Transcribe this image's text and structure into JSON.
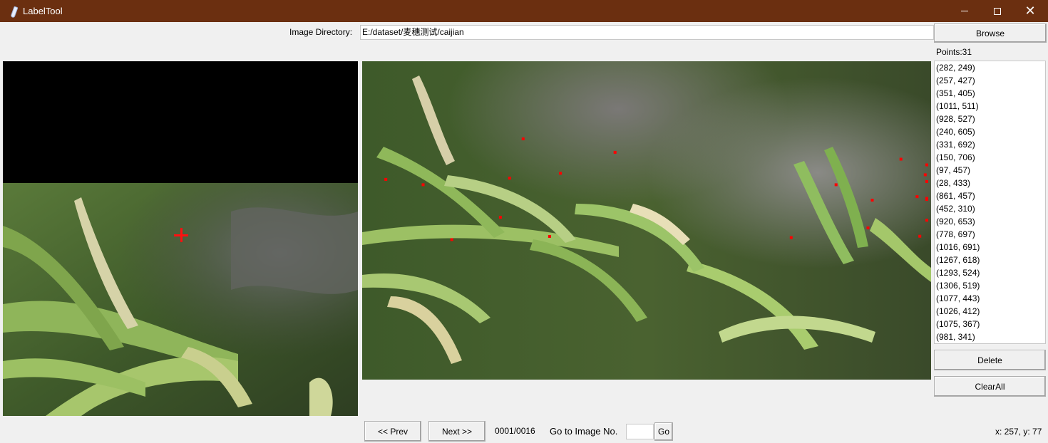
{
  "window": {
    "title": "LabelTool",
    "icon": "feather-icon",
    "controls": [
      "minimize-icon",
      "maximize-icon",
      "close-icon"
    ]
  },
  "directory": {
    "label": "Image Directory:",
    "value": "E:/dataset/麦穗测试/caijian",
    "browse_label": "Browse"
  },
  "points": {
    "label": "Points:31",
    "items": [
      "(282, 249)",
      "(257, 427)",
      "(351, 405)",
      "(1011, 511)",
      "(928, 527)",
      "(240, 605)",
      "(331, 692)",
      "(150, 706)",
      "(97, 457)",
      "(28, 433)",
      "(861, 457)",
      "(452, 310)",
      "(920, 653)",
      "(778, 697)",
      "(1016, 691)",
      "(1267, 618)",
      "(1293, 524)",
      "(1306, 519)",
      "(1077, 443)",
      "(1026, 412)",
      "(1075, 367)",
      "(981, 341)"
    ],
    "delete_label": "Delete",
    "clear_label": "ClearAll"
  },
  "navigation": {
    "prev_label": "<< Prev",
    "next_label": "Next >>",
    "counter": "0001/0016",
    "goto_label": "Go to Image No.",
    "goto_value": "",
    "go_label": "Go"
  },
  "status": {
    "cursor": "x: 257, y: 77"
  },
  "colors": {
    "titlebar": "#6b2f10",
    "marker": "#ff0000"
  }
}
